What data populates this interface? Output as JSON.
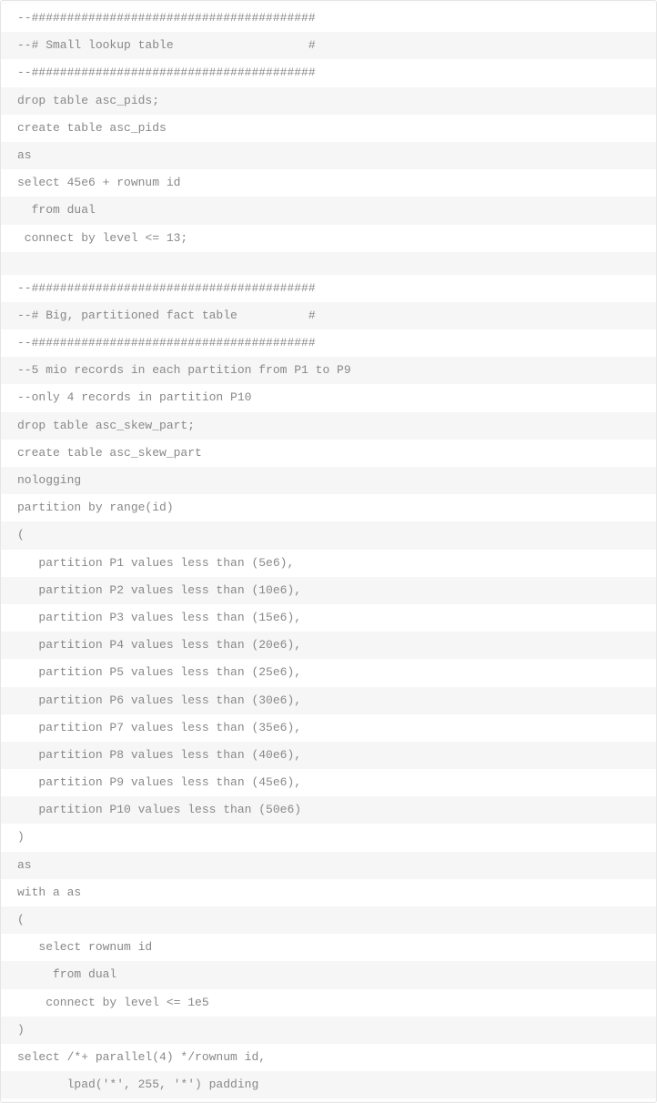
{
  "code": {
    "lines": [
      "--########################################",
      "--# Small lookup table                   #",
      "--########################################",
      "drop table asc_pids;",
      "create table asc_pids",
      "as",
      "select 45e6 + rownum id",
      "  from dual",
      " connect by level <= 13;",
      "",
      "--########################################",
      "--# Big, partitioned fact table          #",
      "--########################################",
      "--5 mio records in each partition from P1 to P9",
      "--only 4 records in partition P10",
      "drop table asc_skew_part;",
      "create table asc_skew_part",
      "nologging",
      "partition by range(id)",
      "(",
      "   partition P1 values less than (5e6),",
      "   partition P2 values less than (10e6),",
      "   partition P3 values less than (15e6),",
      "   partition P4 values less than (20e6),",
      "   partition P5 values less than (25e6),",
      "   partition P6 values less than (30e6),",
      "   partition P7 values less than (35e6),",
      "   partition P8 values less than (40e6),",
      "   partition P9 values less than (45e6),",
      "   partition P10 values less than (50e6)",
      ")",
      "as",
      "with a as",
      "(",
      "   select rownum id",
      "     from dual",
      "    connect by level <= 1e5",
      ")",
      "select /*+ parallel(4) */rownum id,",
      "       lpad('*', 255, '*') padding"
    ]
  }
}
